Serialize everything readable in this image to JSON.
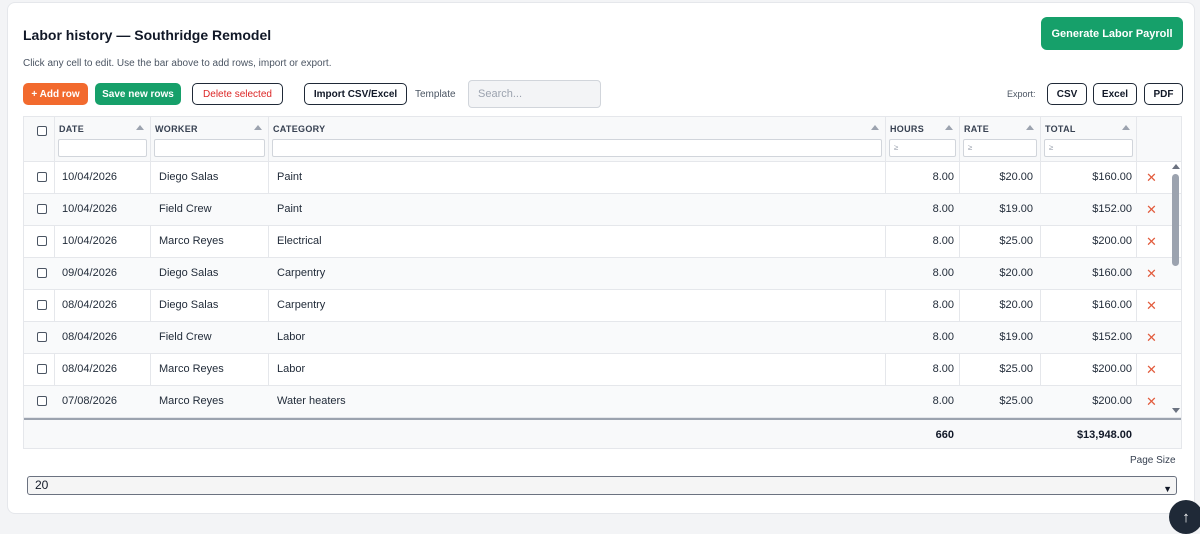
{
  "header": {
    "title": "Labor history — Southridge Remodel",
    "subtitle": "Click any cell to edit. Use the bar above to add rows, import or export.",
    "generate_label": "Generate Labor Payroll"
  },
  "toolbar": {
    "add_row": "+ Add row",
    "save_rows": "Save new rows",
    "delete_selected": "Delete selected",
    "import": "Import CSV/Excel",
    "template": "Template",
    "search_placeholder": "Search...",
    "export_label": "Export:",
    "csv": "CSV",
    "excel": "Excel",
    "pdf": "PDF"
  },
  "grid": {
    "columns": {
      "date": "DATE",
      "worker": "WORKER",
      "category": "CATEGORY",
      "hours": "HOURS",
      "rate": "RATE",
      "total": "TOTAL"
    },
    "filter_symbol": "≥",
    "remove_glyph": "✕",
    "rows": [
      {
        "date": "10/04/2026",
        "worker": "Diego Salas",
        "category": "Paint",
        "hours": "8.00",
        "rate": "$20.00",
        "total": "$160.00"
      },
      {
        "date": "10/04/2026",
        "worker": "Field Crew",
        "category": "Paint",
        "hours": "8.00",
        "rate": "$19.00",
        "total": "$152.00"
      },
      {
        "date": "10/04/2026",
        "worker": "Marco Reyes",
        "category": "Electrical",
        "hours": "8.00",
        "rate": "$25.00",
        "total": "$200.00"
      },
      {
        "date": "09/04/2026",
        "worker": "Diego Salas",
        "category": "Carpentry",
        "hours": "8.00",
        "rate": "$20.00",
        "total": "$160.00"
      },
      {
        "date": "08/04/2026",
        "worker": "Diego Salas",
        "category": "Carpentry",
        "hours": "8.00",
        "rate": "$20.00",
        "total": "$160.00"
      },
      {
        "date": "08/04/2026",
        "worker": "Field Crew",
        "category": "Labor",
        "hours": "8.00",
        "rate": "$19.00",
        "total": "$152.00"
      },
      {
        "date": "08/04/2026",
        "worker": "Marco Reyes",
        "category": "Labor",
        "hours": "8.00",
        "rate": "$25.00",
        "total": "$200.00"
      },
      {
        "date": "07/08/2026",
        "worker": "Marco Reyes",
        "category": "Water heaters",
        "hours": "8.00",
        "rate": "$25.00",
        "total": "$200.00"
      }
    ],
    "totals": {
      "hours": "660",
      "total": "$13,948.00"
    }
  },
  "pagination": {
    "page_size_label": "Page Size",
    "page_size_value": "20"
  },
  "icons": {
    "scroll_top": "up-arrow-icon",
    "remove": "close-icon",
    "sort": "sort-up-icon"
  },
  "colors": {
    "accent_green": "#16a06a",
    "accent_orange": "#f26a2e",
    "danger": "#dc2626"
  }
}
